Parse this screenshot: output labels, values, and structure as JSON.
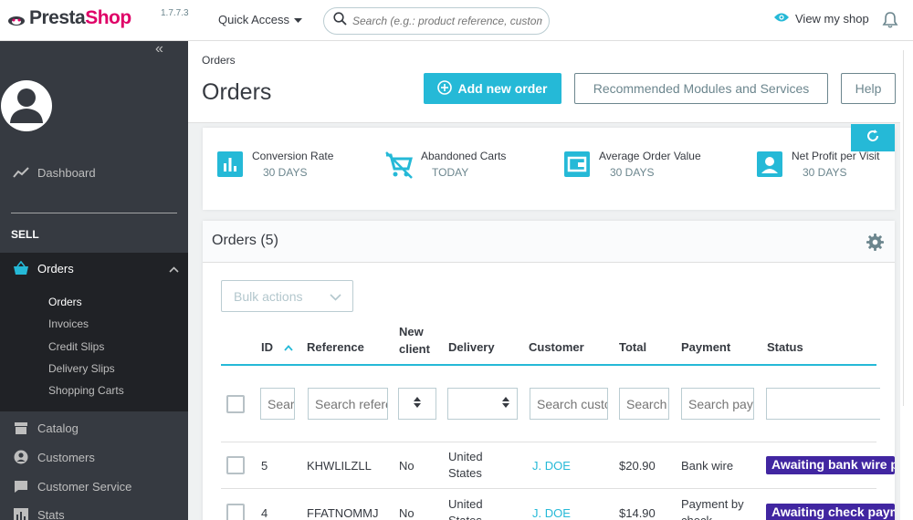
{
  "header": {
    "logo": "PrestaShop",
    "version": "1.7.7.3",
    "quick_access": "Quick Access",
    "search_placeholder": "Search (e.g.: product reference, customer name...)",
    "view_shop": "View my shop"
  },
  "sidebar": {
    "dashboard": "Dashboard",
    "section": "SELL",
    "orders": "Orders",
    "submenu": [
      "Orders",
      "Invoices",
      "Credit Slips",
      "Delivery Slips",
      "Shopping Carts"
    ],
    "items": [
      "Catalog",
      "Customers",
      "Customer Service",
      "Stats"
    ]
  },
  "page": {
    "breadcrumb": "Orders",
    "title": "Orders",
    "add_order": "Add new order",
    "recommended": "Recommended Modules and Services",
    "help": "Help"
  },
  "kpis": [
    {
      "label": "Conversion Rate",
      "sub": "30 DAYS"
    },
    {
      "label": "Abandoned Carts",
      "sub": "TODAY"
    },
    {
      "label": "Average Order Value",
      "sub": "30 DAYS"
    },
    {
      "label": "Net Profit per Visit",
      "sub": "30 DAYS"
    }
  ],
  "orders_panel": {
    "title": "Orders (5)",
    "bulk_actions": "Bulk actions",
    "columns": {
      "id": "ID",
      "reference": "Reference",
      "new_client": "New client",
      "delivery": "Delivery",
      "customer": "Customer",
      "total": "Total",
      "payment": "Payment",
      "status": "Status"
    },
    "filters": {
      "id": "Search ID",
      "reference": "Search reference",
      "customer": "Search customer",
      "total": "Search total",
      "payment": "Search payment"
    },
    "rows": [
      {
        "id": "5",
        "reference": "KHWLILZLL",
        "new_client": "No",
        "delivery": "United States",
        "customer": "J. DOE",
        "total": "$20.90",
        "payment": "Bank wire",
        "status": "Awaiting bank wire payment"
      },
      {
        "id": "4",
        "reference": "FFATNOMMJ",
        "new_client": "No",
        "delivery": "United States",
        "customer": "J. DOE",
        "total": "$14.90",
        "payment": "Payment by check",
        "status": "Awaiting check payment"
      }
    ]
  },
  "colors": {
    "accent": "#25b9d7",
    "sidebar": "#363a41",
    "status_badge": "#4126a1"
  }
}
